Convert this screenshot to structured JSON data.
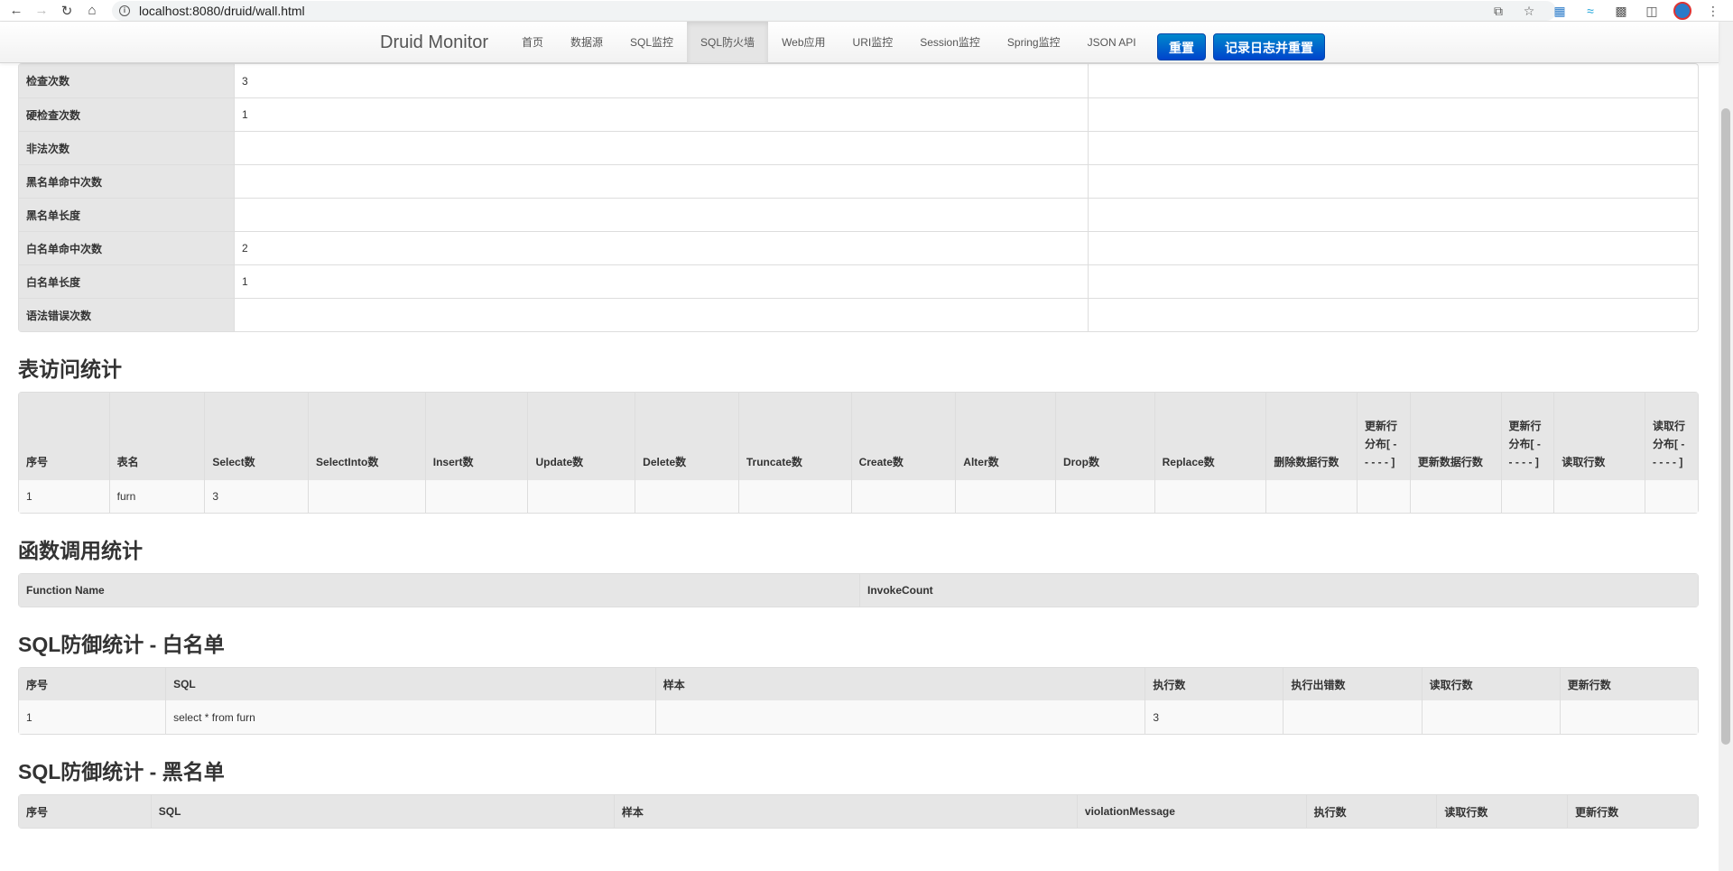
{
  "browser": {
    "url": "localhost:8080/druid/wall.html"
  },
  "navbar": {
    "brand": "Druid Monitor",
    "items": [
      "首页",
      "数据源",
      "SQL监控",
      "SQL防火墙",
      "Web应用",
      "URI监控",
      "Session监控",
      "Spring监控",
      "JSON API"
    ],
    "active_index": 3,
    "reset_button": "重置",
    "log_reset_button": "记录日志并重置"
  },
  "stats": [
    {
      "label": "检查次数",
      "value": "3"
    },
    {
      "label": "硬检查次数",
      "value": "1"
    },
    {
      "label": "非法次数",
      "value": ""
    },
    {
      "label": "黑名单命中次数",
      "value": ""
    },
    {
      "label": "黑名单长度",
      "value": ""
    },
    {
      "label": "白名单命中次数",
      "value": "2"
    },
    {
      "label": "白名单长度",
      "value": "1"
    },
    {
      "label": "语法错误次数",
      "value": ""
    }
  ],
  "table_access": {
    "title": "表访问统计",
    "columns": [
      "序号",
      "表名",
      "Select数",
      "SelectInto数",
      "Insert数",
      "Update数",
      "Delete数",
      "Truncate数",
      "Create数",
      "Alter数",
      "Drop数",
      "Replace数",
      "删除数据行数",
      "更新行分布[ - - - - - ]",
      "更新数据行数",
      "更新行分布[ - - - - - ]",
      "读取行数",
      "读取行分布[ - - - - - ]"
    ],
    "rows": [
      [
        "1",
        "furn",
        "3",
        "",
        "",
        "",
        "",
        "",
        "",
        "",
        "",
        "",
        "",
        "",
        "",
        "",
        "",
        ""
      ]
    ]
  },
  "function_stats": {
    "title": "函数调用统计",
    "columns": [
      "Function Name",
      "InvokeCount"
    ]
  },
  "whitelist": {
    "title": "SQL防御统计 - 白名单",
    "columns": [
      "序号",
      "SQL",
      "样本",
      "执行数",
      "执行出错数",
      "读取行数",
      "更新行数"
    ],
    "rows": [
      [
        "1",
        "select * from furn",
        "",
        "3",
        "",
        "",
        ""
      ]
    ]
  },
  "blacklist": {
    "title": "SQL防御统计 - 黑名单",
    "columns": [
      "序号",
      "SQL",
      "样本",
      "violationMessage",
      "执行数",
      "读取行数",
      "更新行数"
    ]
  }
}
